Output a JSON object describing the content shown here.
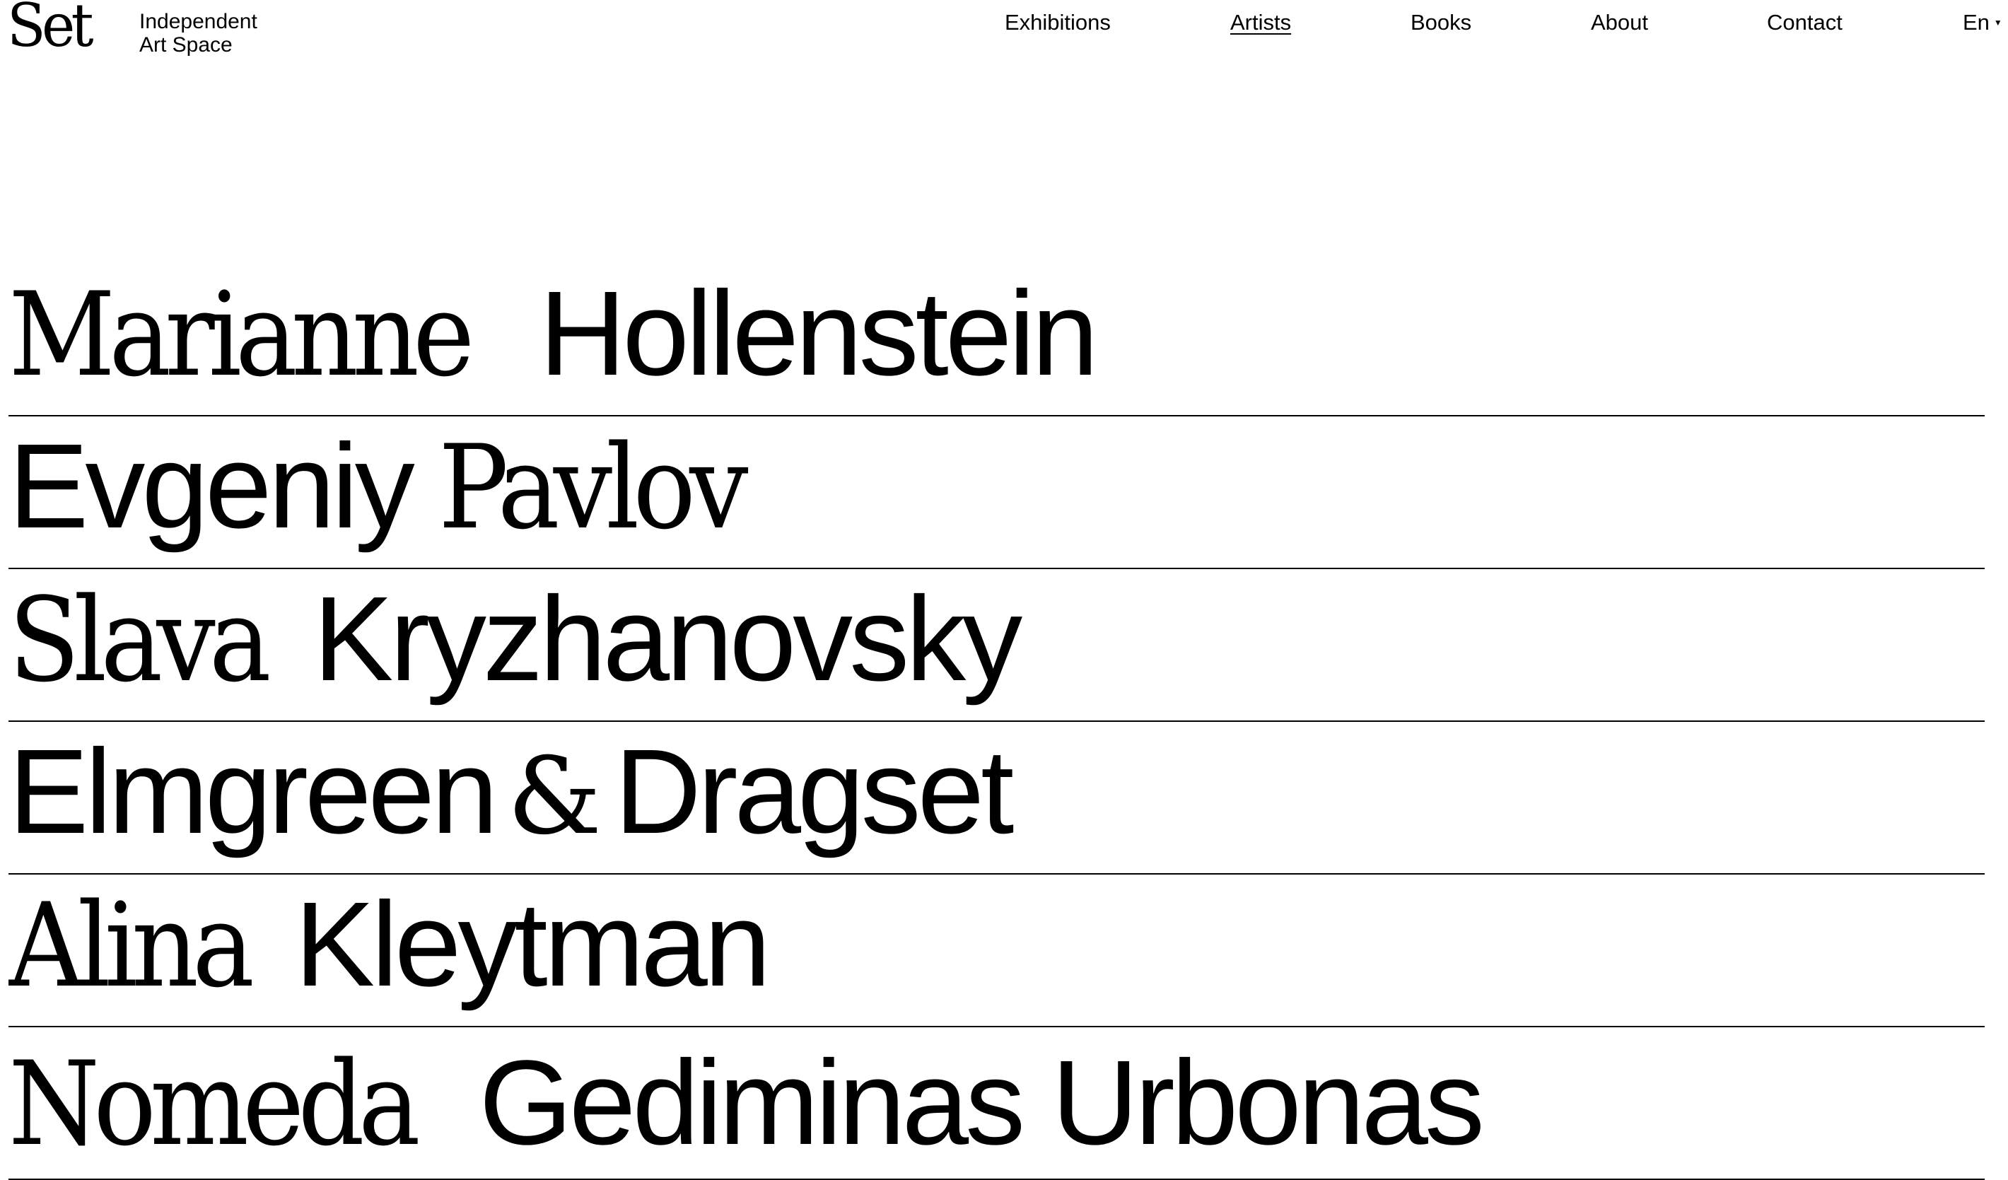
{
  "brand": {
    "logo": "Set",
    "tagline_line1": "Independent",
    "tagline_line2": "Art Space"
  },
  "nav": {
    "exhibitions": "Exhibitions",
    "artists": "Artists",
    "books": "Books",
    "about": "About",
    "contact": "Contact",
    "active": "Artists"
  },
  "language": {
    "current": "En",
    "icon": "caret-down-icon"
  },
  "artists": [
    {
      "first": "Marianne",
      "last": "Hollenstein",
      "first_style": "serif",
      "last_style": "sans"
    },
    {
      "first": "Evgeniy",
      "last": "Pavlov",
      "first_style": "sans",
      "last_style": "serif"
    },
    {
      "first": "Slava",
      "last": "Kryzhanovsky",
      "first_style": "serif",
      "last_style": "sans"
    },
    {
      "first": "Elmgreen",
      "connector": "&",
      "last": "Dragset",
      "first_style": "sans",
      "last_style": "sans"
    },
    {
      "first": "Alina",
      "last": "Kleytman",
      "first_style": "serif",
      "last_style": "sans"
    },
    {
      "first": "Nomeda",
      "last": "Gediminas Urbonas",
      "first_style": "serif",
      "last_style": "sans"
    }
  ]
}
